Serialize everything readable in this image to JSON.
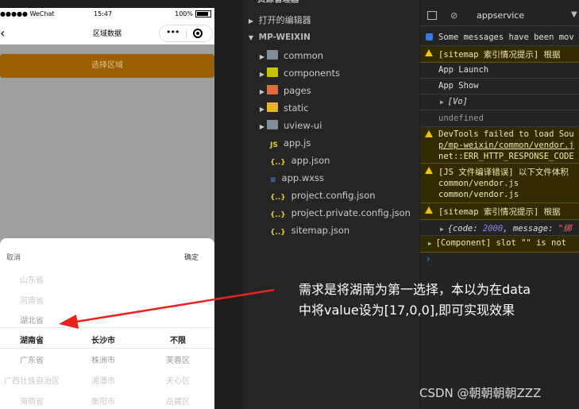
{
  "phone": {
    "status": {
      "carrier": "●●●●● WeChat",
      "time": "15:47",
      "battery": "100%",
      "battery_level": 1.0
    },
    "nav": {
      "back": "‹",
      "title": "区域数据",
      "menu_dots": "•••"
    },
    "select_button": "选择区域",
    "picker": {
      "cancel": "取消",
      "confirm": "确定",
      "province": [
        "山东省",
        "河南省",
        "湖北省",
        "湖南省",
        "广东省",
        "广西壮族自治区",
        "海南省"
      ],
      "city": [
        "长沙市",
        "株洲市",
        "湘潭市",
        "衡阳市"
      ],
      "district": [
        "不限",
        "芙蓉区",
        "天心区",
        "岳麓区"
      ]
    }
  },
  "explorer": {
    "resource_header": "资源管理器",
    "open_editors": "打开的编辑器",
    "project": "MP-WEIXIN",
    "items": [
      {
        "name": "common",
        "type": "folder",
        "color": "#7f8c99"
      },
      {
        "name": "components",
        "type": "folder",
        "color": "#c4c400"
      },
      {
        "name": "pages",
        "type": "folder",
        "color": "#e06b3b"
      },
      {
        "name": "static",
        "type": "folder",
        "color": "#e8b22d"
      },
      {
        "name": "uview-ui",
        "type": "folder",
        "color": "#7f8c99"
      },
      {
        "name": "app.js",
        "type": "js",
        "icon": "JS",
        "color": "#e8c82d"
      },
      {
        "name": "app.json",
        "type": "json",
        "icon": "{..}",
        "color": "#e8c82d"
      },
      {
        "name": "app.wxss",
        "type": "css",
        "icon": "≡",
        "color": "#3b8eea"
      },
      {
        "name": "project.config.json",
        "type": "json",
        "icon": "{..}",
        "color": "#e8c82d"
      },
      {
        "name": "project.private.config.json",
        "type": "json",
        "icon": "{..}",
        "color": "#e8c82d"
      },
      {
        "name": "sitemap.json",
        "type": "json",
        "icon": "{..}",
        "color": "#e8c82d"
      }
    ]
  },
  "console": {
    "context": "appservice",
    "messages": {
      "m1": "Some messages have been mov",
      "m2": "[sitemap 索引情况提示] 根据",
      "m3": "App Launch",
      "m4": "App Show",
      "m5": "[Vo]",
      "m6": "undefined",
      "m7a": "DevTools failed to load Sou",
      "m7b": "p/mp-weixin/common/vendor.j",
      "m7c": "net::ERR_HTTP_RESPONSE_CODE",
      "m8a": "[JS 文件编译错误] 以下文件体积",
      "m8b": "common/vendor.js",
      "m8c": "common/vendor.js",
      "m9": "[sitemap 索引情况提示] 根据",
      "m10_pre": "{code: ",
      "m10_num": "2000",
      "m10_mid": ", message: ",
      "m10_str": "\"绑",
      "m11": "[Component] slot \"\" is not"
    }
  },
  "annotation": {
    "line1": "需求是将湖南为第一选择，本以为在data",
    "line2": "中将value设为[17,0,0],即可实现效果"
  },
  "watermark": "CSDN @朝朝朝朝ZZZ"
}
